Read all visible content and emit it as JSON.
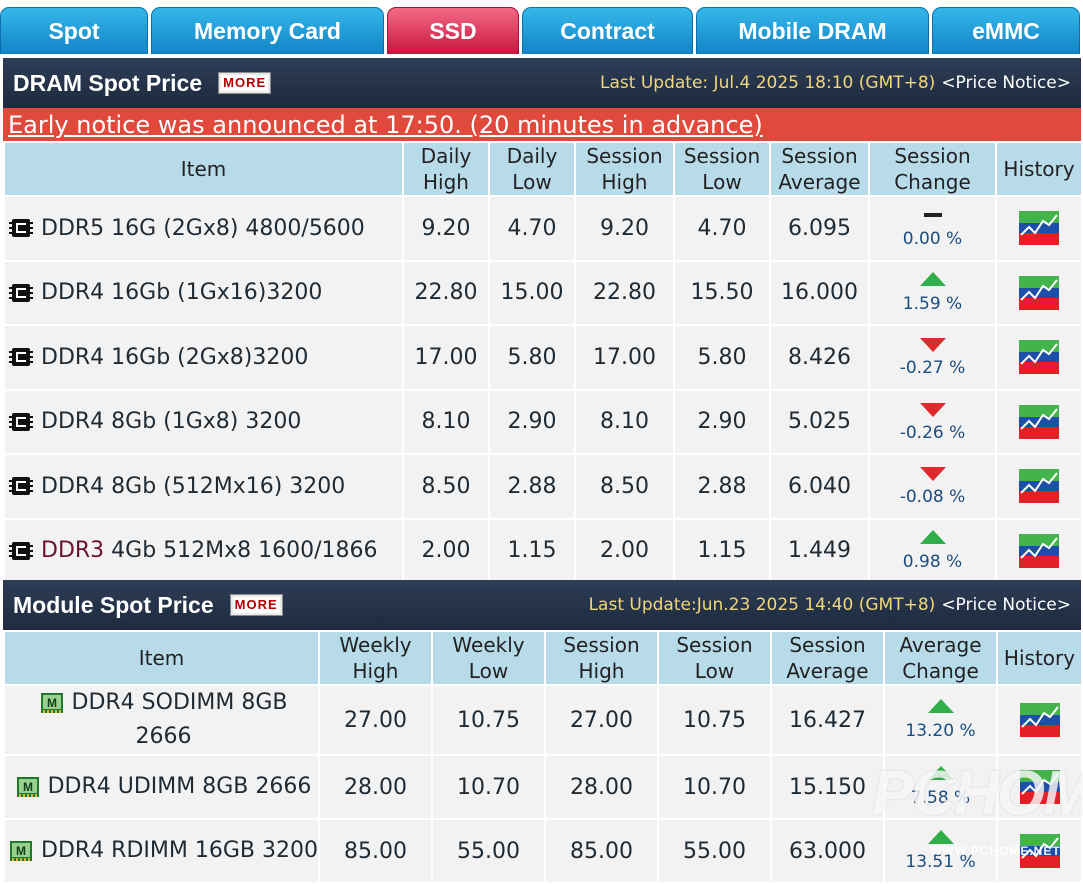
{
  "tabs": [
    {
      "label": "Spot",
      "active": false
    },
    {
      "label": "Memory Card",
      "active": false
    },
    {
      "label": "SSD",
      "active": true
    },
    {
      "label": "Contract",
      "active": false
    },
    {
      "label": "Mobile DRAM",
      "active": false
    },
    {
      "label": "eMMC",
      "active": false
    }
  ],
  "dram": {
    "title": "DRAM Spot Price",
    "more_label": "MORE",
    "last_update": "Last Update: Jul.4 2025 18:10 (GMT+8)",
    "price_notice": "<Price Notice>",
    "notice": "Early notice was announced at 17:50. (20 minutes in advance)",
    "headers": {
      "item": "Item",
      "daily_high_1": "Daily",
      "daily_high_2": "High",
      "daily_low_1": "Daily",
      "daily_low_2": "Low",
      "session_high_1": "Session",
      "session_high_2": "High",
      "session_low_1": "Session",
      "session_low_2": "Low",
      "session_avg_1": "Session",
      "session_avg_2": "Average",
      "session_chg_1": "Session",
      "session_chg_2": "Change",
      "history": "History"
    },
    "rows": [
      {
        "item": "DDR5 16G (2Gx8) 4800/5600",
        "item_prefix": "",
        "daily_high": "9.20",
        "daily_low": "4.70",
        "session_high": "9.20",
        "session_low": "4.70",
        "session_avg": "6.095",
        "change": "0.00 %",
        "trend": "flat"
      },
      {
        "item": "DDR4 16Gb (1Gx16)3200",
        "item_prefix": "",
        "daily_high": "22.80",
        "daily_low": "15.00",
        "session_high": "22.80",
        "session_low": "15.50",
        "session_avg": "16.000",
        "change": "1.59 %",
        "trend": "up"
      },
      {
        "item": "DDR4 16Gb (2Gx8)3200",
        "item_prefix": "",
        "daily_high": "17.00",
        "daily_low": "5.80",
        "session_high": "17.00",
        "session_low": "5.80",
        "session_avg": "8.426",
        "change": "-0.27 %",
        "trend": "down"
      },
      {
        "item": "DDR4 8Gb (1Gx8) 3200",
        "item_prefix": "",
        "daily_high": "8.10",
        "daily_low": "2.90",
        "session_high": "8.10",
        "session_low": "2.90",
        "session_avg": "5.025",
        "change": "-0.26 %",
        "trend": "down"
      },
      {
        "item": "DDR4 8Gb (512Mx16) 3200",
        "item_prefix": "",
        "daily_high": "8.50",
        "daily_low": "2.88",
        "session_high": "8.50",
        "session_low": "2.88",
        "session_avg": "6.040",
        "change": "-0.08 %",
        "trend": "down"
      },
      {
        "item": " 4Gb 512Mx8 1600/1866",
        "item_prefix": "DDR3",
        "daily_high": "2.00",
        "daily_low": "1.15",
        "session_high": "2.00",
        "session_low": "1.15",
        "session_avg": "1.449",
        "change": "0.98 %",
        "trend": "up"
      }
    ]
  },
  "module": {
    "title": "Module Spot Price",
    "more_label": "MORE",
    "last_update": "Last Update:Jun.23 2025 14:40 (GMT+8)",
    "price_notice": "<Price Notice>",
    "headers": {
      "item": "Item",
      "weekly_high_1": "Weekly",
      "weekly_high_2": "High",
      "weekly_low_1": "Weekly",
      "weekly_low_2": "Low",
      "session_high_1": "Session",
      "session_high_2": "High",
      "session_low_1": "Session",
      "session_low_2": "Low",
      "session_avg_1": "Session",
      "session_avg_2": "Average",
      "avg_chg_1": "Average",
      "avg_chg_2": "Change",
      "history": "History"
    },
    "rows": [
      {
        "item": "DDR4 SODIMM 8GB 2666",
        "weekly_high": "27.00",
        "weekly_low": "10.75",
        "session_high": "27.00",
        "session_low": "10.75",
        "session_avg": "16.427",
        "change": "13.20 %",
        "trend": "up"
      },
      {
        "item": "DDR4 UDIMM 8GB 2666",
        "weekly_high": "28.00",
        "weekly_low": "10.70",
        "session_high": "28.00",
        "session_low": "10.70",
        "session_avg": "15.150",
        "change": "7.58 %",
        "trend": "up"
      },
      {
        "item": "DDR4 RDIMM 16GB 3200",
        "weekly_high": "85.00",
        "weekly_low": "55.00",
        "session_high": "85.00",
        "session_low": "55.00",
        "session_avg": "63.000",
        "change": "13.51 %",
        "trend": "up"
      }
    ]
  },
  "watermark": {
    "text": "PCHOME",
    "sub": "WWW.PCHOME.NET"
  },
  "colors": {
    "up": "#2fae4a",
    "down": "#e0282f",
    "flat": "#222222",
    "tab_active": "#d21f48",
    "tab": "#1b95d6"
  }
}
